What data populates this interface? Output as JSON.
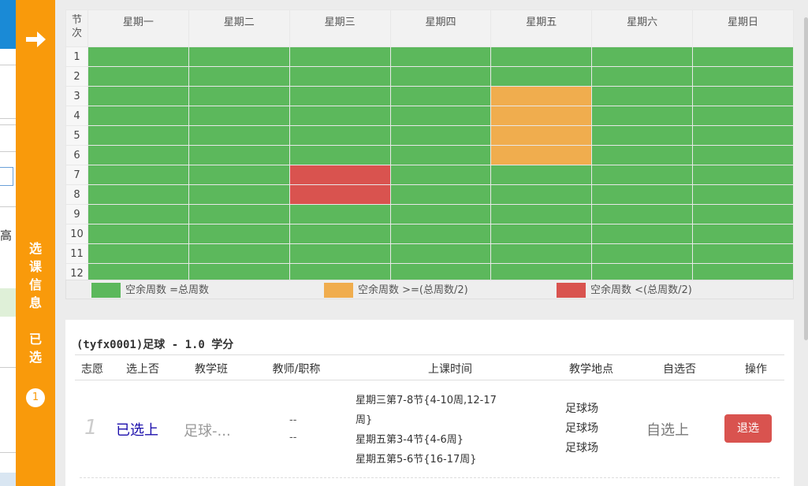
{
  "background": {
    "partial_text": "高",
    "partial_text_accent": "1"
  },
  "side_panel": {
    "arrow_icon": "arrow-right-icon",
    "label_chars": [
      "选",
      "课",
      "信",
      "息"
    ],
    "tab_chars": [
      "已",
      "选"
    ],
    "count": "1"
  },
  "schedule": {
    "corner_label": [
      "节",
      "次"
    ],
    "days": [
      "星期一",
      "星期二",
      "星期三",
      "星期四",
      "星期五",
      "星期六",
      "星期日"
    ],
    "periods": [
      "1",
      "2",
      "3",
      "4",
      "5",
      "6",
      "7",
      "8",
      "9",
      "10",
      "11",
      "12"
    ],
    "colors": {
      "free": "#5cb85c",
      "half": "#f0ad4e",
      "low": "#d9534f"
    }
  },
  "legend": {
    "full": "空余周数 =总周数",
    "half": "空余周数 >=(总周数/2)",
    "low": "空余周数 <(总周数/2)"
  },
  "course": {
    "title": "(tyfx0001)足球 - 1.0 学分",
    "headers": [
      "志愿",
      "选上否",
      "教学班",
      "教师/职称",
      "上课时间",
      "教学地点",
      "自选否",
      "操作"
    ],
    "row": {
      "priority": "1",
      "selected": "已选上",
      "class_name": "足球-...",
      "teacher": "--",
      "title": "--",
      "times": [
        "星期三第7-8节{4-10周,12-17",
        "周}",
        "星期五第3-4节{4-6周}",
        "星期五第5-6节{16-17周}"
      ],
      "places": [
        "足球场",
        "足球场",
        "足球场"
      ],
      "self_selected": "自选上",
      "action": "退选"
    }
  }
}
